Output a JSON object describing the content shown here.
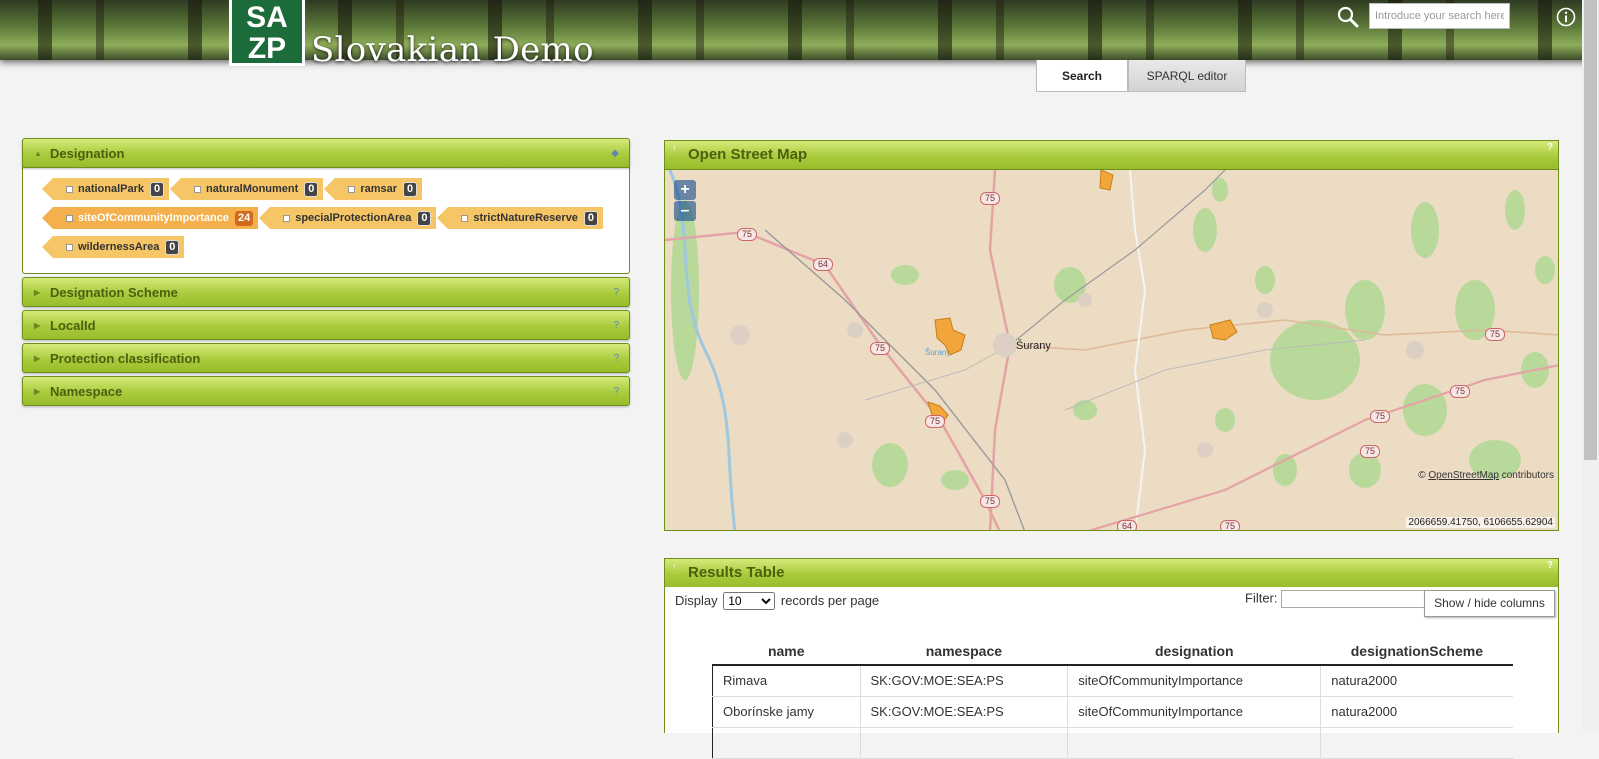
{
  "header": {
    "site_title": "Slovakian Demo",
    "search_placeholder": "Introduce your search here",
    "logo_icon": "sazp-logo",
    "search_icon": "search-icon",
    "info_icon": "info-icon"
  },
  "tabs": [
    {
      "label": "Search",
      "active": true
    },
    {
      "label": "SPARQL editor",
      "active": false
    }
  ],
  "facets": {
    "designation": {
      "title": "Designation",
      "tags": [
        {
          "label": "nationalPark",
          "count": "0",
          "selected": false
        },
        {
          "label": "naturalMonument",
          "count": "0",
          "selected": false
        },
        {
          "label": "ramsar",
          "count": "0",
          "selected": false
        },
        {
          "label": "siteOfCommunityImportance",
          "count": "24",
          "selected": true
        },
        {
          "label": "specialProtectionArea",
          "count": "0",
          "selected": false
        },
        {
          "label": "strictNatureReserve",
          "count": "0",
          "selected": false
        },
        {
          "label": "wildernessArea",
          "count": "0",
          "selected": false
        }
      ]
    },
    "collapsed": [
      {
        "title": "Designation Scheme",
        "help": "?"
      },
      {
        "title": "LocalId",
        "help": "?"
      },
      {
        "title": "Protection classification",
        "help": "?"
      },
      {
        "title": "Namespace",
        "help": "?"
      }
    ]
  },
  "map": {
    "title": "Open Street Map",
    "zoom_in": "+",
    "zoom_out": "–",
    "attribution_prefix": "©",
    "attribution_link": "OpenStreetMap",
    "attribution_suffix": "contributors",
    "coordinates": "2066659.41750, 6106655.62904",
    "town_label": "Šurany",
    "small_town_label": "Šurany",
    "road_labels": [
      "75",
      "64",
      "75",
      "75",
      "75",
      "75",
      "64",
      "75",
      "75",
      "75",
      "75",
      "75"
    ]
  },
  "results": {
    "title": "Results Table",
    "display_label": "Display",
    "display_value": "10",
    "display_suffix": "records per page",
    "filter_label": "Filter:",
    "show_hide_label": "Show / hide columns",
    "columns": [
      "name",
      "namespace",
      "designation",
      "designationScheme"
    ],
    "rows": [
      [
        "Rimava",
        "SK:GOV:MOE:SEA:PS",
        "siteOfCommunityImportance",
        "natura2000"
      ],
      [
        "Oborínske jamy",
        "SK:GOV:MOE:SEA:PS",
        "siteOfCommunityImportance",
        "natura2000"
      ]
    ]
  }
}
